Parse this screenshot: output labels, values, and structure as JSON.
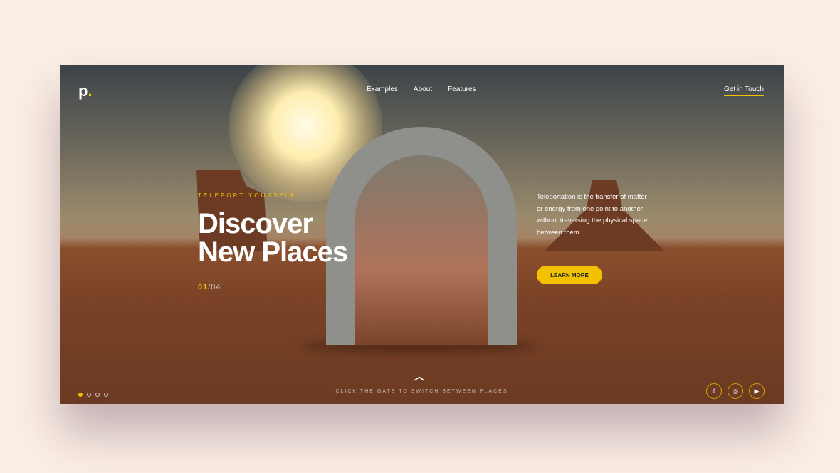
{
  "brand": {
    "logo": "p",
    "logo_dot": "."
  },
  "nav": {
    "items": [
      "Examples",
      "About",
      "Features"
    ],
    "cta": "Get in Touch"
  },
  "hero": {
    "kicker": "TELEPORT YOURSELF",
    "title_line1": "Discover",
    "title_line2": "New Places",
    "current": "01",
    "total": "/04",
    "description": "Teleportation is the transfer of matter or energy from one point to another without traversing the physical space between them.",
    "button": "LEARN MORE"
  },
  "footer": {
    "up_icon": "chevron-up-icon",
    "hint": "CLICK THE GATE TO SWITCH BETWEEN PLACES",
    "active_slide": 1,
    "slides": 4,
    "social": [
      {
        "icon": "facebook-icon",
        "glyph": "f"
      },
      {
        "icon": "instagram-icon",
        "glyph": "◎"
      },
      {
        "icon": "youtube-icon",
        "glyph": "▶"
      }
    ]
  },
  "colors": {
    "accent": "#f2c200",
    "page_bg": "#fbeee4"
  }
}
